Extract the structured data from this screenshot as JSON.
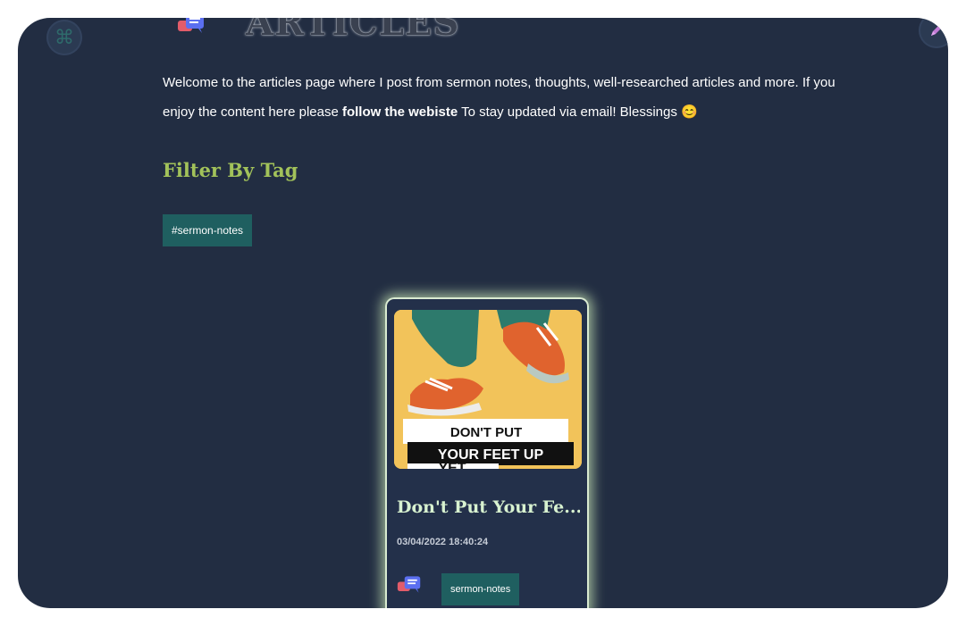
{
  "header": {
    "title": "ARTICLES",
    "left_button_icon": "command-icon",
    "right_button_icon": "pen-icon",
    "heading_icon": "chat-bubbles-icon"
  },
  "intro": {
    "text_before": "Welcome to the articles page where I post from sermon notes, thoughts, well-researched articles and more. If you enjoy the content here please ",
    "link_text": "follow the webiste",
    "text_after": " To stay updated via email! Blessings ",
    "emoji": "😊"
  },
  "filter": {
    "title": "Filter By Tag",
    "tags": [
      "#sermon-notes"
    ]
  },
  "articles": [
    {
      "image_text_line1": "DON'T PUT",
      "image_text_line2": "YOUR FEET UP",
      "image_text_line3": "YET",
      "title": "Don't Put Your Fe...",
      "date": "03/04/2022 18:40:24",
      "tag": "sermon-notes",
      "icon": "chat-bubbles-icon"
    }
  ],
  "colors": {
    "background": "#222d42",
    "accent_green": "#a2c25a",
    "tag_bg": "#1f5f60",
    "card_title": "#d8f2d0"
  }
}
